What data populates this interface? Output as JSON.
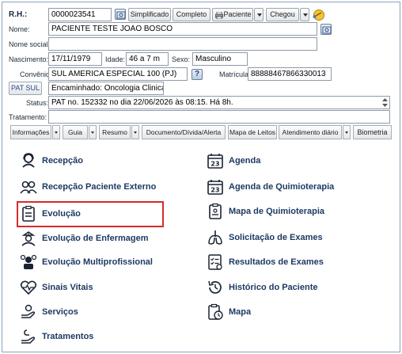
{
  "form": {
    "rh_label": "R.H.:",
    "rh_value": "0000023541",
    "btn_simplificado": "Simplificado",
    "btn_completo": "Completo",
    "btn_paciente": "Paciente",
    "btn_chegou": "Chegou",
    "nome_label": "Nome:",
    "nome_value": "PACIENTE TESTE JOAO BOSCO",
    "nome_social_label": "Nome social:",
    "nome_social_value": "",
    "nascimento_label": "Nascimento:",
    "nascimento_value": "17/11/1979",
    "idade_label": "Idade:",
    "idade_value": "46 a 7 m",
    "sexo_label": "Sexo:",
    "sexo_value": "Masculino",
    "convenio_label": "Convênio:",
    "convenio_value": "SUL AMERICA ESPECIAL 100 (PJ)",
    "help_glyph": "?",
    "matricula_label": "Matrícula:",
    "matricula_value": "88888467866330013",
    "pat_sul_label": "PAT SUL",
    "encaminhado_value": "Encaminhado: Oncologia Clinica",
    "status_label": "Status:",
    "status_value": "PAT no. 152332 no dia 22/06/2026  às  08:15. Há 8h.",
    "tratamento_label": "Tratamento:",
    "tratamento_value": ""
  },
  "toolbar": {
    "informacoes": "Informações",
    "guia": "Guia",
    "resumo": "Resumo",
    "documento": "Documento/Dívida/Alerta",
    "mapa_leitos": "Mapa de Leitos",
    "atendimento": "Atendimento diário",
    "biometria": "Biometria"
  },
  "menu": {
    "left": [
      {
        "label": "Recepção",
        "icon": "receptionist-icon"
      },
      {
        "label": "Recepção Paciente Externo",
        "icon": "people-icon"
      },
      {
        "label": "Evolução",
        "icon": "clipboard-list-icon"
      },
      {
        "label": "Evolução de Enfermagem",
        "icon": "nurse-icon"
      },
      {
        "label": "Evolução Multiprofissional",
        "icon": "multiprofessional-icon"
      },
      {
        "label": "Sinais Vitais",
        "icon": "heartbeat-icon"
      },
      {
        "label": "Serviços",
        "icon": "hand-service-icon"
      },
      {
        "label": "Tratamentos",
        "icon": "treatment-hand-icon"
      }
    ],
    "right": [
      {
        "label": "Agenda",
        "icon": "calendar-23-icon"
      },
      {
        "label": "Agenda de Quimioterapia",
        "icon": "calendar-23-icon"
      },
      {
        "label": "Mapa de Quimioterapia",
        "icon": "clipboard-icon"
      },
      {
        "label": "Solicitação de Exames",
        "icon": "lungs-icon"
      },
      {
        "label": "Resultados de Exames",
        "icon": "checklist-icon"
      },
      {
        "label": "Histórico do Paciente",
        "icon": "history-icon"
      },
      {
        "label": "Mapa",
        "icon": "clipboard-clock-icon"
      }
    ],
    "highlighted": "Evolução"
  },
  "colors": {
    "menu_text": "#1d3a63",
    "highlight_border": "#d62b2b",
    "frame_border": "#8aa3c2"
  }
}
